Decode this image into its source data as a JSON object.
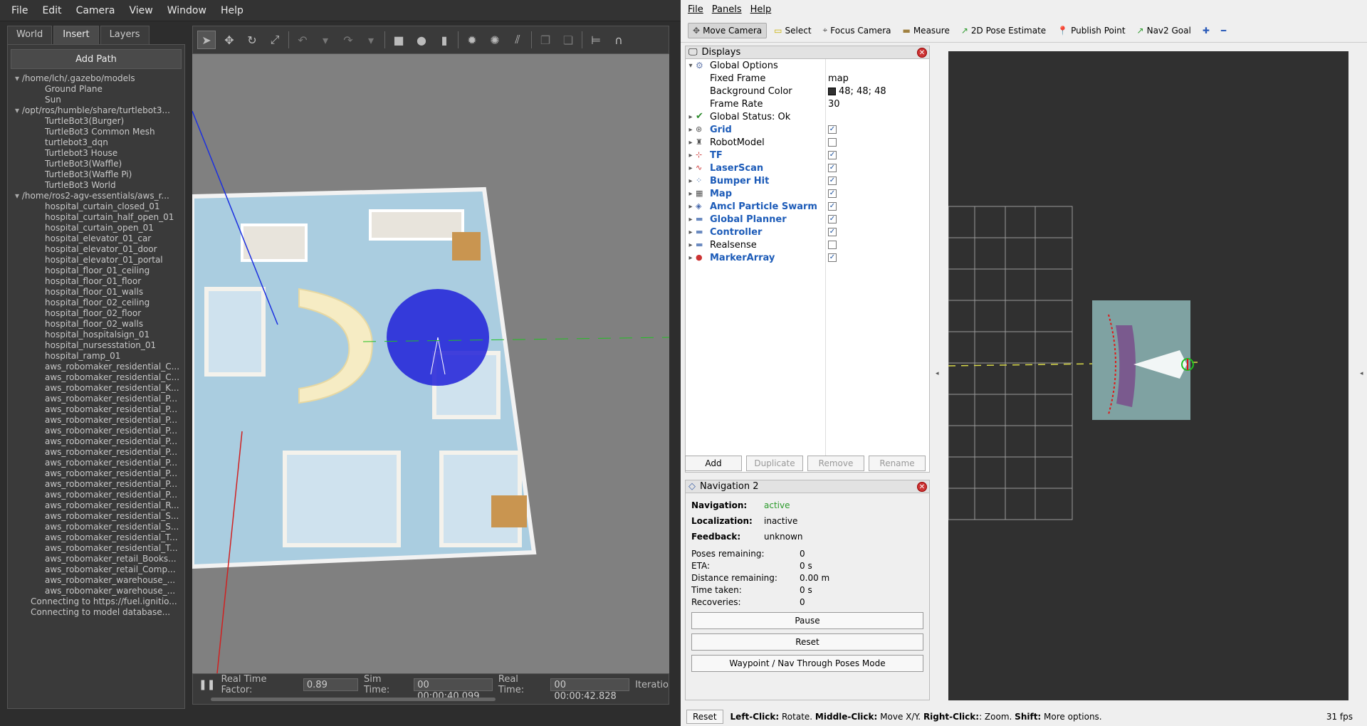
{
  "gazebo": {
    "menu": [
      "File",
      "Edit",
      "Camera",
      "View",
      "Window",
      "Help"
    ],
    "tabs": [
      "World",
      "Insert",
      "Layers"
    ],
    "active_tab": "Insert",
    "add_path": "Add Path",
    "tree": [
      {
        "type": "root",
        "text": "/home/lch/.gazebo/models"
      },
      {
        "type": "leaf",
        "text": "Ground Plane"
      },
      {
        "type": "leaf",
        "text": "Sun"
      },
      {
        "type": "root",
        "text": "/opt/ros/humble/share/turtlebot3..."
      },
      {
        "type": "leaf",
        "text": "TurtleBot3(Burger)"
      },
      {
        "type": "leaf",
        "text": "TurtleBot3 Common Mesh"
      },
      {
        "type": "leaf",
        "text": "turtlebot3_dqn"
      },
      {
        "type": "leaf",
        "text": "Turtlebot3 House"
      },
      {
        "type": "leaf",
        "text": "TurtleBot3(Waffle)"
      },
      {
        "type": "leaf",
        "text": "TurtleBot3(Waffle Pi)"
      },
      {
        "type": "leaf",
        "text": "TurtleBot3 World"
      },
      {
        "type": "root",
        "text": "/home/ros2-agv-essentials/aws_r..."
      },
      {
        "type": "leaf",
        "text": "hospital_curtain_closed_01"
      },
      {
        "type": "leaf",
        "text": "hospital_curtain_half_open_01"
      },
      {
        "type": "leaf",
        "text": "hospital_curtain_open_01"
      },
      {
        "type": "leaf",
        "text": "hospital_elevator_01_car"
      },
      {
        "type": "leaf",
        "text": "hospital_elevator_01_door"
      },
      {
        "type": "leaf",
        "text": "hospital_elevator_01_portal"
      },
      {
        "type": "leaf",
        "text": "hospital_floor_01_ceiling"
      },
      {
        "type": "leaf",
        "text": "hospital_floor_01_floor"
      },
      {
        "type": "leaf",
        "text": "hospital_floor_01_walls"
      },
      {
        "type": "leaf",
        "text": "hospital_floor_02_ceiling"
      },
      {
        "type": "leaf",
        "text": "hospital_floor_02_floor"
      },
      {
        "type": "leaf",
        "text": "hospital_floor_02_walls"
      },
      {
        "type": "leaf",
        "text": "hospital_hospitalsign_01"
      },
      {
        "type": "leaf",
        "text": "hospital_nursesstation_01"
      },
      {
        "type": "leaf",
        "text": "hospital_ramp_01"
      },
      {
        "type": "leaf",
        "text": "aws_robomaker_residential_C..."
      },
      {
        "type": "leaf",
        "text": "aws_robomaker_residential_C..."
      },
      {
        "type": "leaf",
        "text": "aws_robomaker_residential_K..."
      },
      {
        "type": "leaf",
        "text": "aws_robomaker_residential_P..."
      },
      {
        "type": "leaf",
        "text": "aws_robomaker_residential_P..."
      },
      {
        "type": "leaf",
        "text": "aws_robomaker_residential_P..."
      },
      {
        "type": "leaf",
        "text": "aws_robomaker_residential_P..."
      },
      {
        "type": "leaf",
        "text": "aws_robomaker_residential_P..."
      },
      {
        "type": "leaf",
        "text": "aws_robomaker_residential_P..."
      },
      {
        "type": "leaf",
        "text": "aws_robomaker_residential_P..."
      },
      {
        "type": "leaf",
        "text": "aws_robomaker_residential_P..."
      },
      {
        "type": "leaf",
        "text": "aws_robomaker_residential_P..."
      },
      {
        "type": "leaf",
        "text": "aws_robomaker_residential_P..."
      },
      {
        "type": "leaf",
        "text": "aws_robomaker_residential_R..."
      },
      {
        "type": "leaf",
        "text": "aws_robomaker_residential_S..."
      },
      {
        "type": "leaf",
        "text": "aws_robomaker_residential_S..."
      },
      {
        "type": "leaf",
        "text": "aws_robomaker_residential_T..."
      },
      {
        "type": "leaf",
        "text": "aws_robomaker_residential_T..."
      },
      {
        "type": "leaf",
        "text": "aws_robomaker_retail_Books..."
      },
      {
        "type": "leaf",
        "text": "aws_robomaker_retail_Comp..."
      },
      {
        "type": "leaf",
        "text": "aws_robomaker_warehouse_..."
      },
      {
        "type": "leaf",
        "text": "aws_robomaker_warehouse_..."
      },
      {
        "type": "conn",
        "text": "Connecting to https://fuel.ignitio..."
      },
      {
        "type": "conn",
        "text": "Connecting to model database..."
      }
    ],
    "status": {
      "rtf_label": "Real Time Factor:",
      "rtf": "0.89",
      "sim_label": "Sim Time:",
      "sim": "00 00:00:40.099",
      "real_label": "Real Time:",
      "real": "00 00:00:42.828",
      "iter_label": "Iteratio"
    }
  },
  "rviz": {
    "menu": [
      "File",
      "Panels",
      "Help"
    ],
    "tools": [
      {
        "label": "Move Camera",
        "icon": "move-camera-icon",
        "active": true
      },
      {
        "label": "Select",
        "icon": "select-icon"
      },
      {
        "label": "Focus Camera",
        "icon": "focus-camera-icon"
      },
      {
        "label": "Measure",
        "icon": "measure-icon"
      },
      {
        "label": "2D Pose Estimate",
        "icon": "pose-estimate-icon"
      },
      {
        "label": "Publish Point",
        "icon": "publish-point-icon"
      },
      {
        "label": "Nav2 Goal",
        "icon": "nav2-goal-icon"
      }
    ],
    "displays_title": "Displays",
    "global_options": "Global Options",
    "options": [
      {
        "label": "Fixed Frame",
        "value": "map"
      },
      {
        "label": "Background Color",
        "value": "48; 48; 48"
      },
      {
        "label": "Frame Rate",
        "value": "30"
      }
    ],
    "global_status": "Global Status: Ok",
    "displays": [
      {
        "label": "Grid",
        "checked": true,
        "bold": true
      },
      {
        "label": "RobotModel",
        "checked": false,
        "bold": false
      },
      {
        "label": "TF",
        "checked": true,
        "bold": true
      },
      {
        "label": "LaserScan",
        "checked": true,
        "bold": true
      },
      {
        "label": "Bumper Hit",
        "checked": true,
        "bold": true
      },
      {
        "label": "Map",
        "checked": true,
        "bold": true
      },
      {
        "label": "Amcl Particle Swarm",
        "checked": true,
        "bold": true
      },
      {
        "label": "Global Planner",
        "checked": true,
        "bold": true
      },
      {
        "label": "Controller",
        "checked": true,
        "bold": true
      },
      {
        "label": "Realsense",
        "checked": false,
        "bold": false
      },
      {
        "label": "MarkerArray",
        "checked": true,
        "bold": true
      }
    ],
    "buttons": [
      "Add",
      "Duplicate",
      "Remove",
      "Rename"
    ],
    "nav_title": "Navigation 2",
    "nav": [
      {
        "label": "Navigation:",
        "value": "active",
        "color": "#2a9a2a"
      },
      {
        "label": "Localization:",
        "value": "inactive",
        "color": "#000000"
      },
      {
        "label": "Feedback:",
        "value": "unknown",
        "color": "#000000"
      }
    ],
    "stats": [
      {
        "label": "Poses remaining:",
        "value": "0"
      },
      {
        "label": "ETA:",
        "value": "0 s"
      },
      {
        "label": "Distance remaining:",
        "value": "0.00 m"
      },
      {
        "label": "Time taken:",
        "value": "0 s"
      },
      {
        "label": "Recoveries:",
        "value": "0"
      }
    ],
    "nav_buttons": [
      "Pause",
      "Reset",
      "Waypoint / Nav Through Poses Mode"
    ],
    "bottom": {
      "reset": "Reset",
      "hint_1b": "Left-Click:",
      "hint_1": " Rotate. ",
      "hint_2b": "Middle-Click:",
      "hint_2": " Move X/Y. ",
      "hint_3b": "Right-Click:",
      "hint_3": ": Zoom. ",
      "hint_4b": "Shift:",
      "hint_4": " More options.",
      "fps": "31 fps"
    },
    "bg_color": "#303030"
  }
}
